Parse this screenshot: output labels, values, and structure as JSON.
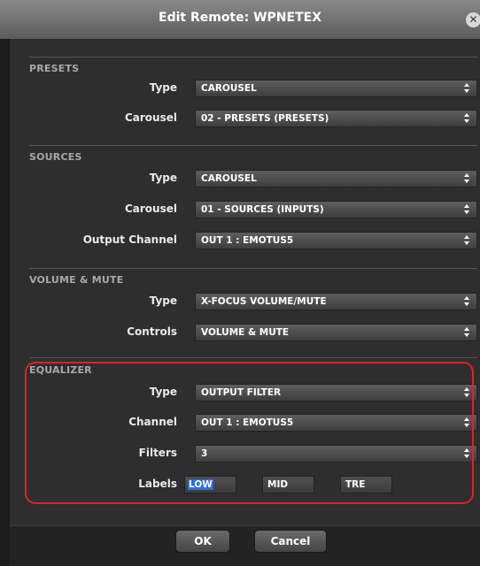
{
  "window": {
    "title": "Edit Remote: WPNETEX",
    "close_icon": "close-circle-icon"
  },
  "presets": {
    "title": "PRESETS",
    "type_label": "Type",
    "type_value": "CAROUSEL",
    "carousel_label": "Carousel",
    "carousel_value": "02 - PRESETS (PRESETS)"
  },
  "sources": {
    "title": "SOURCES",
    "type_label": "Type",
    "type_value": "CAROUSEL",
    "carousel_label": "Carousel",
    "carousel_value": "01 - SOURCES (INPUTS)",
    "output_label": "Output Channel",
    "output_value": "OUT 1 : EMOTUS5"
  },
  "volume": {
    "title": "VOLUME & MUTE",
    "type_label": "Type",
    "type_value": "X-FOCUS VOLUME/MUTE",
    "controls_label": "Controls",
    "controls_value": "VOLUME & MUTE"
  },
  "equalizer": {
    "title": "EQUALIZER",
    "type_label": "Type",
    "type_value": "OUTPUT FILTER",
    "channel_label": "Channel",
    "channel_value": "OUT 1 : EMOTUS5",
    "filters_label": "Filters",
    "filters_value": "3",
    "labels_label": "Labels",
    "label_values": [
      "LOW",
      "MID",
      "TRE"
    ]
  },
  "footer": {
    "ok_label": "OK",
    "cancel_label": "Cancel"
  },
  "colors": {
    "highlight_border": "#e0202b",
    "selection": "#2e6fe0",
    "titlebar": "#7a7a7a"
  }
}
